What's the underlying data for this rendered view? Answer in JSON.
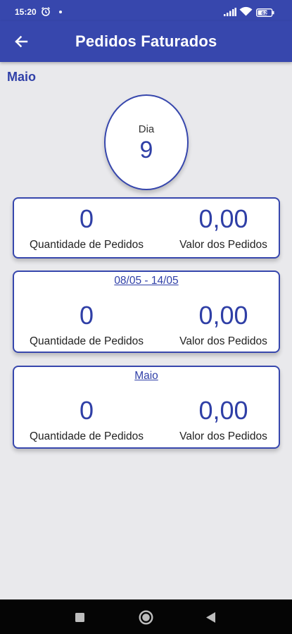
{
  "status_bar": {
    "time": "15:20",
    "battery": "62"
  },
  "app_bar": {
    "title": "Pedidos Faturados"
  },
  "month_label": "Maio",
  "day": {
    "label": "Dia",
    "value": "9"
  },
  "cards": [
    {
      "period": "",
      "quantity": "0",
      "quantity_label": "Quantidade de Pedidos",
      "value": "0,00",
      "value_label": "Valor dos Pedidos"
    },
    {
      "period": "08/05  -  14/05",
      "quantity": "0",
      "quantity_label": "Quantidade de Pedidos",
      "value": "0,00",
      "value_label": "Valor dos Pedidos"
    },
    {
      "period": "Maio",
      "quantity": "0",
      "quantity_label": "Quantidade de Pedidos",
      "value": "0,00",
      "value_label": "Valor dos Pedidos"
    }
  ],
  "colors": {
    "primary": "#3747ad",
    "accent_text": "#2f3fa6",
    "background": "#e9e9ec"
  },
  "icons": {
    "back": "arrow-left-icon",
    "alarm": "alarm-icon",
    "signal": "signal-icon",
    "wifi": "wifi-icon",
    "battery": "battery-icon",
    "nav_recent": "square-icon",
    "nav_home": "circle-icon",
    "nav_back": "triangle-icon"
  }
}
